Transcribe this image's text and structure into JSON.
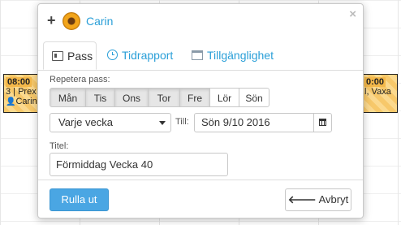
{
  "background": {
    "shift_left": {
      "time": "08:00",
      "line2": "3 | Prex",
      "person": "Carin"
    },
    "shift_right": {
      "time": "0:00",
      "line2": "l, Vaxa"
    }
  },
  "popover": {
    "person_name": "Carin",
    "close": "×",
    "tabs": [
      {
        "label": "Pass",
        "icon": "id-card-icon",
        "active": true
      },
      {
        "label": "Tidrapport",
        "icon": "clock-icon"
      },
      {
        "label": "Tillgänglighet",
        "icon": "calendar-icon"
      }
    ],
    "repeat_label": "Repetera pass:",
    "days": [
      {
        "label": "Mån",
        "selected": true
      },
      {
        "label": "Tis",
        "selected": true
      },
      {
        "label": "Ons",
        "selected": true
      },
      {
        "label": "Tor",
        "selected": true
      },
      {
        "label": "Fre",
        "selected": true
      },
      {
        "label": "Lör",
        "selected": false
      },
      {
        "label": "Sön",
        "selected": false
      }
    ],
    "frequency_value": "Varje vecka",
    "till_label": "Till:",
    "till_date": "Sön 9/10 2016",
    "title_label": "Titel:",
    "title_value": "Förmiddag Vecka 40",
    "primary_button": "Rulla ut",
    "back_button": "Avbryt"
  },
  "colors": {
    "accent": "#2a9fd8",
    "primary_button": "#4aa6e3"
  }
}
